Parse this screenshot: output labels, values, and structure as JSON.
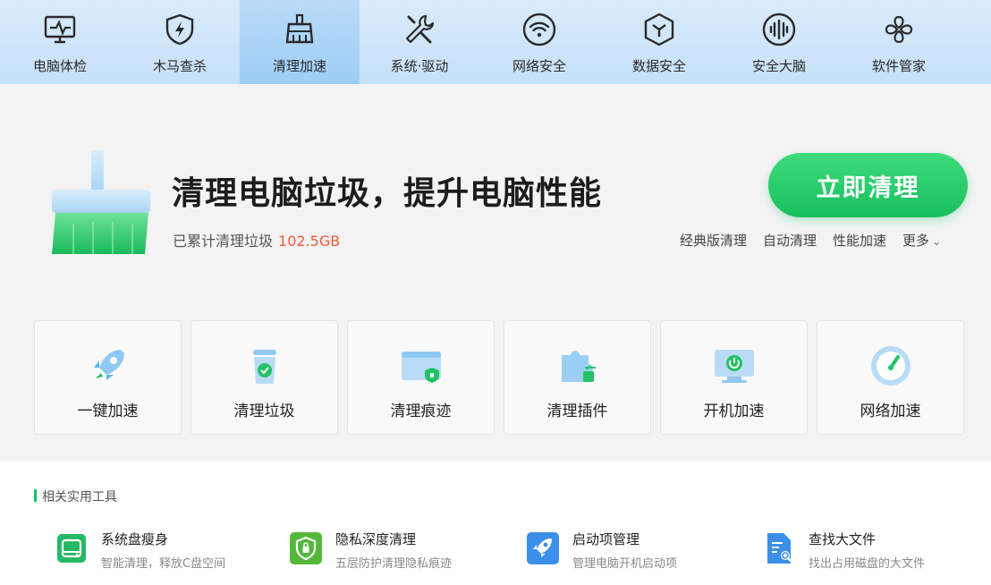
{
  "nav": {
    "items": [
      {
        "label": "电脑体检",
        "icon": "monitor-pulse-icon"
      },
      {
        "label": "木马查杀",
        "icon": "shield-bolt-icon"
      },
      {
        "label": "清理加速",
        "icon": "broom-icon",
        "active": true
      },
      {
        "label": "系统·驱动",
        "icon": "wrench-screwdriver-icon"
      },
      {
        "label": "网络安全",
        "icon": "wifi-icon"
      },
      {
        "label": "数据安全",
        "icon": "cube-icon"
      },
      {
        "label": "安全大脑",
        "icon": "brain-wave-icon"
      },
      {
        "label": "软件管家",
        "icon": "apps-icon"
      }
    ]
  },
  "hero": {
    "title": "清理电脑垃圾，提升电脑性能",
    "sub_label": "已累计清理垃圾",
    "sub_value": "102.5GB",
    "cta": "立即清理",
    "links": [
      "经典版清理",
      "自动清理",
      "性能加速",
      "更多"
    ]
  },
  "cards": [
    {
      "label": "一键加速",
      "icon": "rocket-icon"
    },
    {
      "label": "清理垃圾",
      "icon": "recycle-bin-icon"
    },
    {
      "label": "清理痕迹",
      "icon": "browser-shield-icon"
    },
    {
      "label": "清理插件",
      "icon": "puzzle-icon"
    },
    {
      "label": "开机加速",
      "icon": "power-monitor-icon"
    },
    {
      "label": "网络加速",
      "icon": "speed-gauge-icon"
    }
  ],
  "tools": {
    "title": "相关实用工具",
    "items": [
      {
        "name": "系统盘瘦身",
        "desc": "智能清理，释放C盘空间",
        "icon": "disk-icon",
        "color": "#25b865"
      },
      {
        "name": "隐私深度清理",
        "desc": "五层防护清理隐私痕迹",
        "icon": "privacy-shield-icon",
        "color": "#53b83a"
      },
      {
        "name": "启动项管理",
        "desc": "管理电脑开机启动项",
        "icon": "rocket-icon",
        "color": "#3b8fe8"
      },
      {
        "name": "查找大文件",
        "desc": "找出占用磁盘的大文件",
        "icon": "file-search-icon",
        "color": "#3b8fe8"
      }
    ]
  },
  "colors": {
    "accent": "#18c05e",
    "highlight": "#f35b3a",
    "nav_bg": "#c6e0f7"
  }
}
